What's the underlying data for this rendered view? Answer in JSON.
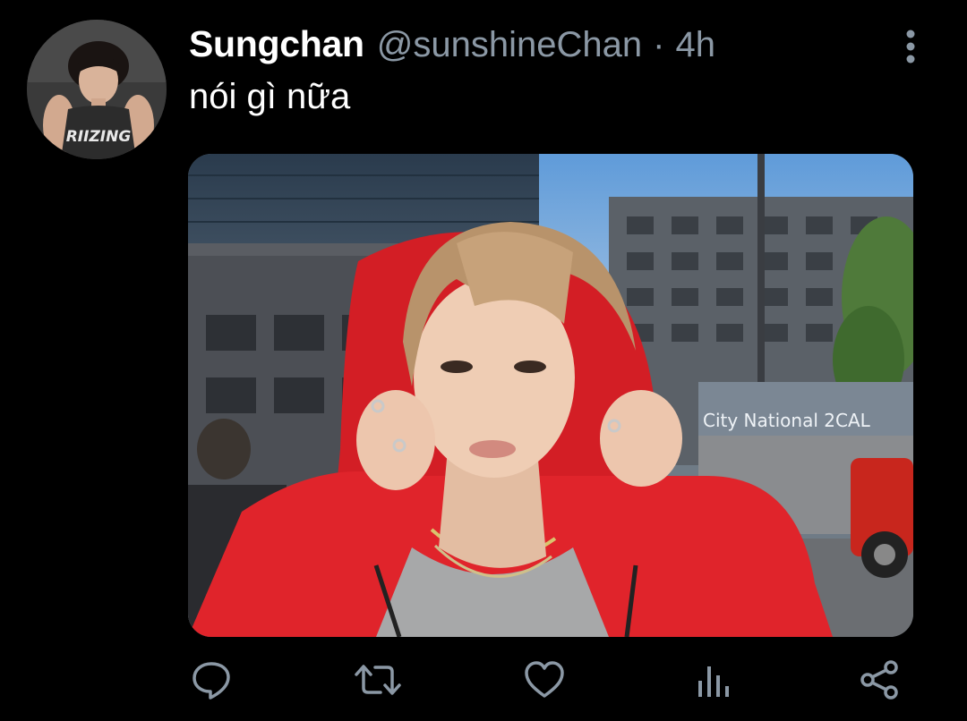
{
  "tweet": {
    "display_name": "Sungchan",
    "handle": "@sunshineChan",
    "separator": "·",
    "time": "4h",
    "text": "nói gì nữa",
    "media": {
      "sign_text": "City National 2CAL"
    },
    "avatar": {
      "shirt_text": "RIIZING"
    }
  },
  "actions": {
    "reply_icon": "reply-icon",
    "retweet_icon": "retweet-icon",
    "like_icon": "heart-icon",
    "views_icon": "views-icon",
    "share_icon": "share-icon",
    "more_icon": "more-vertical-icon"
  },
  "colors": {
    "background": "#000000",
    "name": "#ffffff",
    "secondary": "#8b98a5",
    "icon": "#8b98a5"
  }
}
